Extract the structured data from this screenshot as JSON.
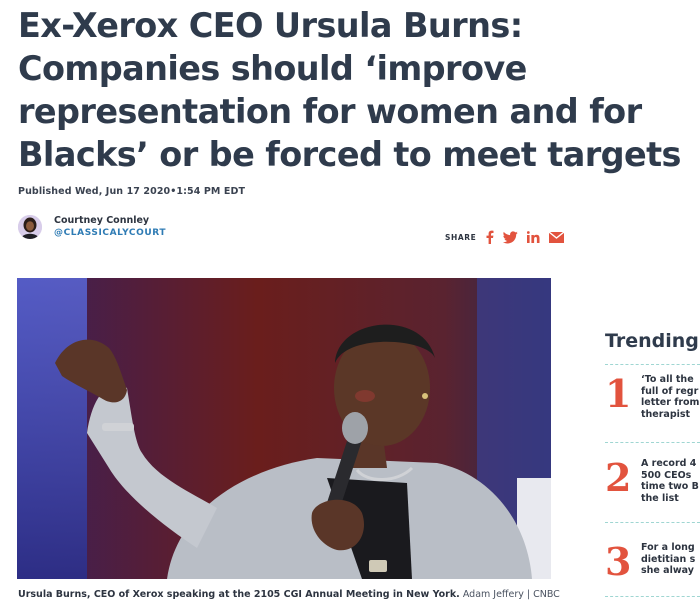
{
  "article": {
    "headline_lines": [
      "Ex-Xerox CEO Ursula Burns:",
      "Companies should ‘improve",
      "representation for women and for",
      "Blacks’ or be forced to meet targets"
    ],
    "published": "Published Wed, Jun 17 2020•1:54 PM EDT",
    "author_name": "Courtney Connley",
    "author_handle": "@CLASSICALYCOURT",
    "share_label": "SHARE",
    "caption_main": "Ursula Burns, CEO of Xerox speaking at the 2105 CGI Annual Meeting in New York.",
    "caption_credit": "Adam Jeffery | CNBC"
  },
  "share_icons": [
    "facebook-icon",
    "twitter-icon",
    "linkedin-icon",
    "email-icon"
  ],
  "trending": {
    "title": "Trending",
    "items": [
      {
        "num": "1",
        "text": "‘To all the\nfull of regr\nletter from\ntherapist"
      },
      {
        "num": "2",
        "text": "A record 4\n500 CEOs\ntime two B\nthe list"
      },
      {
        "num": "3",
        "text": "For a long\ndietitian s\nshe alway"
      }
    ]
  },
  "colors": {
    "headline": "#2f3b4c",
    "accent_red": "#e2533e",
    "link_blue": "#2e7bb4",
    "divider_teal": "#9fd6d2"
  }
}
